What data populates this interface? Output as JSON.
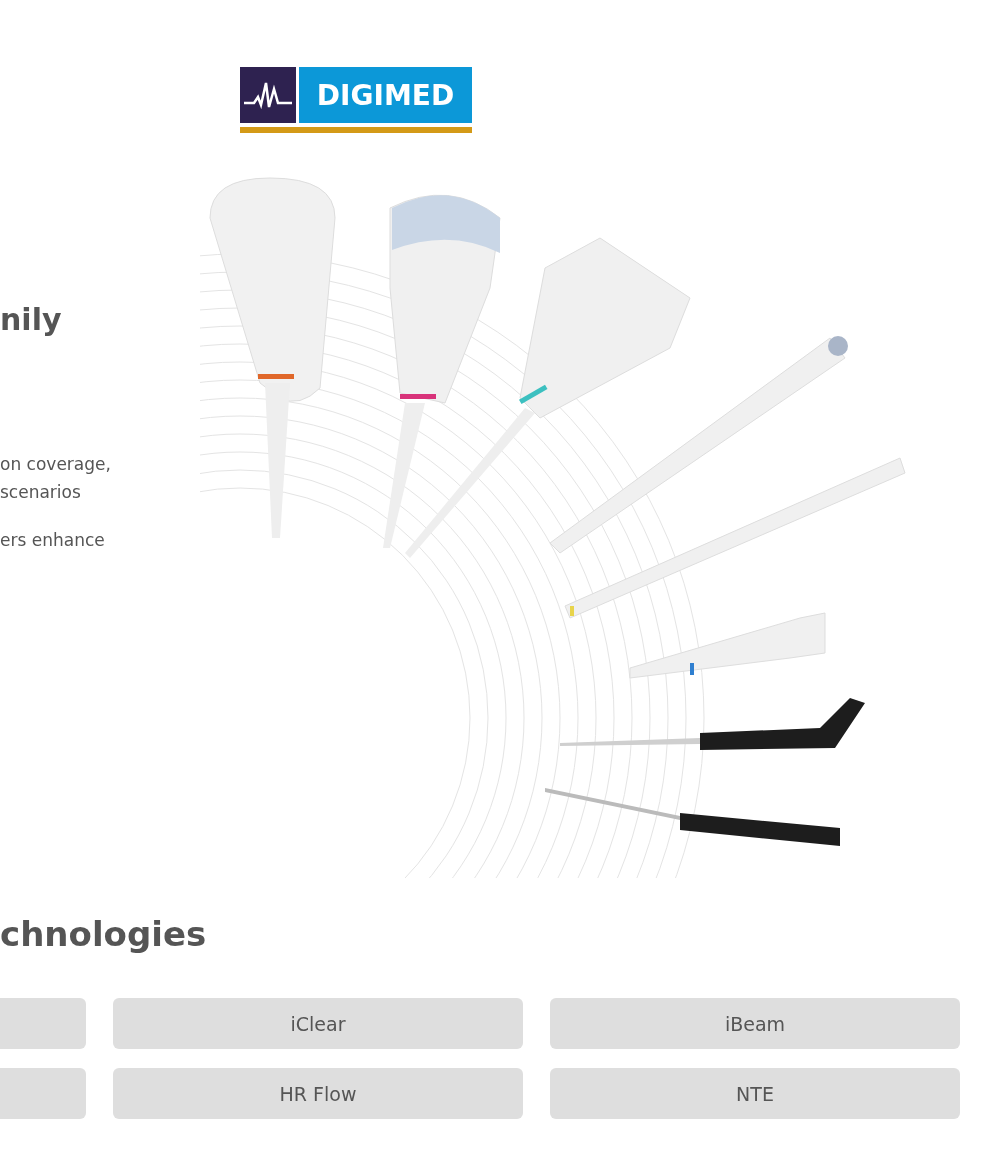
{
  "logo": {
    "text": "DIGIMED"
  },
  "family": {
    "heading": "nily",
    "paragraphs": [
      {
        "lines": [
          "on coverage,",
          "scenarios"
        ]
      },
      {
        "lines": [
          "ers enhance"
        ]
      }
    ]
  },
  "technologies": {
    "heading": "chnologies",
    "rows": [
      {
        "cells": [
          {
            "kind": "cut"
          },
          {
            "kind": "button",
            "label": "iClear"
          },
          {
            "kind": "button",
            "label": "iBeam"
          }
        ]
      },
      {
        "cells": [
          {
            "kind": "cut"
          },
          {
            "kind": "button",
            "label": "HR Flow"
          },
          {
            "kind": "button",
            "label": "NTE"
          }
        ]
      }
    ]
  }
}
